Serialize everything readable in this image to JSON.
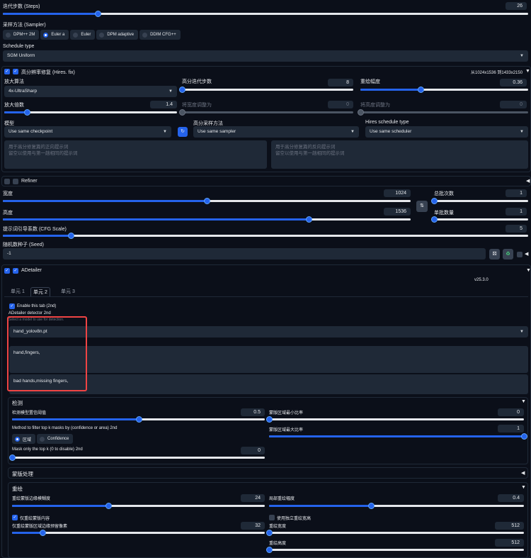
{
  "steps": {
    "label": "迭代步数 (Steps)",
    "value": "26",
    "fraction": 0.18
  },
  "sampler": {
    "label": "采样方法 (Sampler)",
    "options": [
      "DPM++ 2M",
      "Euler a",
      "Euler",
      "DPM adaptive",
      "DDIM CFG++"
    ],
    "selected": "Euler a"
  },
  "schedule": {
    "label": "Schedule type",
    "value": "SGM Uniform"
  },
  "hires": {
    "title": "高分辨率修复 (Hires. fix)",
    "size_text": "从1024x1536 到1433x2150",
    "upscaler_label": "放大算法",
    "upscaler_value": "4x-UltraSharp",
    "hires_steps_label": "高分迭代步数",
    "hires_steps_value": "8",
    "hires_steps_fraction": 0.0,
    "denoise_label": "重绘幅度",
    "denoise_value": "0.36",
    "denoise_fraction": 0.36,
    "upscale_by_label": "放大倍数",
    "upscale_by_value": "1.4",
    "upscale_by_fraction": 0.13,
    "resize_w_label": "将宽度调整为",
    "resize_w_value": "0",
    "resize_h_label": "将高度调整为",
    "resize_h_value": "0",
    "checkpoint_label": "模型",
    "checkpoint_value": "Use same checkpoint",
    "sampler_label": "高分采样方法",
    "sampler_value": "Use same sampler",
    "scheduler_label": "Hires schedule type",
    "scheduler_value": "Use same scheduler",
    "prompt_placeholder": "用于高分修复篇的正向提示词\n留空以使用与第一趟相同的提示词",
    "neg_prompt_placeholder": "用于高分修复篇的反向提示词\n留空以使用与第一趟相同的提示词"
  },
  "refiner": {
    "title": "Refiner"
  },
  "width": {
    "label": "宽度",
    "value": "1024",
    "fraction": 0.5
  },
  "height": {
    "label": "高度",
    "value": "1536",
    "fraction": 0.75
  },
  "batch_count": {
    "label": "总批次数",
    "value": "1"
  },
  "batch_size": {
    "label": "单批数量",
    "value": "1"
  },
  "cfg": {
    "label": "提示词引导系数 (CFG Scale)",
    "value": "5",
    "fraction": 0.13
  },
  "seed": {
    "label": "随机数种子 (Seed)",
    "value": "-1"
  },
  "adetailer": {
    "title": "ADetailer",
    "version": "v25.3.0",
    "tabs": [
      "单元 1",
      "单元 2",
      "单元 3"
    ],
    "active_tab": "单元 2",
    "enable_label": "Enable this tab (2nd)",
    "detector_label": "ADetailer detector 2nd",
    "detector_hint": "Select a model to use for detection.",
    "model_value": "hand_yolov8n.pt",
    "prompt_value": "hand,fingers,",
    "neg_prompt_value": "bad hands,missing fingers,",
    "detection": {
      "title": "检测",
      "confidence_label": "检测模型置信阈值",
      "confidence_value": "0.5",
      "confidence_fraction": 0.5,
      "min_ratio_label": "蒙版区域最小比率",
      "min_ratio_value": "0",
      "max_ratio_label": "蒙版区域最大比率",
      "max_ratio_value": "1",
      "method_label": "Method to filter top k masks by (confidence or area) 2nd",
      "method_options": [
        "区域",
        "Confidence"
      ],
      "method_selected": "区域",
      "topk_label": "Mask only the top k (0 to disable) 2nd",
      "topk_value": "0"
    },
    "mask_processing": {
      "title": "蒙版处理"
    },
    "inpaint": {
      "title": "重绘",
      "blur_label": "重绘蒙版边缘模糊度",
      "blur_value": "24",
      "blur_fraction": 0.38,
      "denoise_label": "局部重绘幅度",
      "denoise_value": "0.4",
      "denoise_fraction": 0.4,
      "only_masked_label": "仅重绘蒙版内容",
      "padding_label": "仅重绘蒙版区域边缘预留像素",
      "padding_value": "32",
      "padding_fraction": 0.12,
      "separate_size_label": "使用独立重绘宽高",
      "width_label": "重绘宽度",
      "width_value": "512",
      "height_label": "重绘高度",
      "height_value": "512"
    }
  }
}
